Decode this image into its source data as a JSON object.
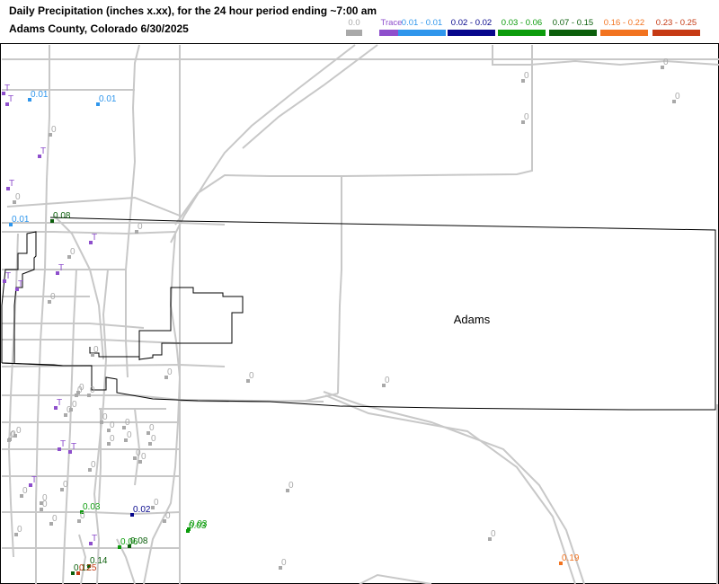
{
  "header": {
    "title": "Daily Precipitation (inches  x.xx),  for the 24 hour period ending ~7:00 am",
    "subtitle": "Adams County, Colorado  6/30/2025"
  },
  "legend": [
    {
      "label": "0.0",
      "color": "#a9a9a9"
    },
    {
      "label": "Trace",
      "color": "#8e4fcc"
    },
    {
      "label": "0.01 - 0.01",
      "color": "#2f96ec"
    },
    {
      "label": "0.02 - 0.02",
      "color": "#07078c"
    },
    {
      "label": "0.03 - 0.06",
      "color": "#0c9c0c"
    },
    {
      "label": "0.07 - 0.15",
      "color": "#0b5f0b"
    },
    {
      "label": "0.16 - 0.22",
      "color": "#f2731f"
    },
    {
      "label": "0.23 - 0.25",
      "color": "#c63a14"
    }
  ],
  "map": {
    "county_name": "Adams",
    "stations": [
      {
        "label": "T",
        "cat": 1
      },
      {
        "label": "T",
        "cat": 1
      },
      {
        "label": "0.01",
        "cat": 2
      },
      {
        "label": "0.01",
        "cat": 2
      },
      {
        "label": "0",
        "cat": 0
      },
      {
        "label": "T",
        "cat": 1
      },
      {
        "label": "0",
        "cat": 0
      },
      {
        "label": "T",
        "cat": 1
      },
      {
        "label": "0",
        "cat": 0
      },
      {
        "label": "0.01",
        "cat": 2
      },
      {
        "label": "0.08",
        "cat": 5
      },
      {
        "label": "0",
        "cat": 0
      },
      {
        "label": "T",
        "cat": 1
      },
      {
        "label": "0",
        "cat": 0
      },
      {
        "label": "T",
        "cat": 1
      },
      {
        "label": "T",
        "cat": 1
      },
      {
        "label": "0",
        "cat": 0
      },
      {
        "label": "0",
        "cat": 0
      },
      {
        "label": "T",
        "cat": 1
      },
      {
        "label": "0",
        "cat": 0
      },
      {
        "label": "0",
        "cat": 0
      },
      {
        "label": "T",
        "cat": 1
      },
      {
        "label": "0",
        "cat": 0
      },
      {
        "label": "0",
        "cat": 0
      },
      {
        "label": "0",
        "cat": 0
      },
      {
        "label": "0",
        "cat": 0
      },
      {
        "label": "0",
        "cat": 0
      },
      {
        "label": "0",
        "cat": 0
      },
      {
        "label": "0",
        "cat": 0
      },
      {
        "label": "0",
        "cat": 0
      },
      {
        "label": "0",
        "cat": 0
      },
      {
        "label": "0",
        "cat": 0
      },
      {
        "label": "T",
        "cat": 1
      },
      {
        "label": "T",
        "cat": 1
      },
      {
        "label": "0",
        "cat": 0
      },
      {
        "label": "0",
        "cat": 0
      },
      {
        "label": "0",
        "cat": 0
      },
      {
        "label": "0",
        "cat": 0
      },
      {
        "label": "0",
        "cat": 0
      },
      {
        "label": "T",
        "cat": 1
      },
      {
        "label": "0",
        "cat": 0
      },
      {
        "label": "0",
        "cat": 0
      },
      {
        "label": "0",
        "cat": 0
      },
      {
        "label": "0",
        "cat": 0
      },
      {
        "label": "0.03",
        "cat": 4
      },
      {
        "label": "0.02",
        "cat": 3
      },
      {
        "label": "0",
        "cat": 0
      },
      {
        "label": "0.03",
        "cat": 4
      },
      {
        "label": "0.03",
        "cat": 4
      },
      {
        "label": "T",
        "cat": 1
      },
      {
        "label": "0.06",
        "cat": 4
      },
      {
        "label": "0.08",
        "cat": 5
      },
      {
        "label": "0.14",
        "cat": 5
      },
      {
        "label": "0.12",
        "cat": 5
      },
      {
        "label": "0.25",
        "cat": 7
      },
      {
        "label": "0",
        "cat": 0
      },
      {
        "label": "0",
        "cat": 0
      },
      {
        "label": "0",
        "cat": 0
      },
      {
        "label": "0",
        "cat": 0
      },
      {
        "label": "0",
        "cat": 0
      },
      {
        "label": "0",
        "cat": 0
      },
      {
        "label": "0",
        "cat": 0
      },
      {
        "label": "0.19",
        "cat": 6
      },
      {
        "label": "0",
        "cat": 0
      },
      {
        "label": "0",
        "cat": 0
      },
      {
        "label": "0",
        "cat": 0
      },
      {
        "label": "0",
        "cat": 0
      },
      {
        "label": "0",
        "cat": 0
      },
      {
        "label": "0",
        "cat": 0
      },
      {
        "label": "0",
        "cat": 0
      }
    ]
  }
}
